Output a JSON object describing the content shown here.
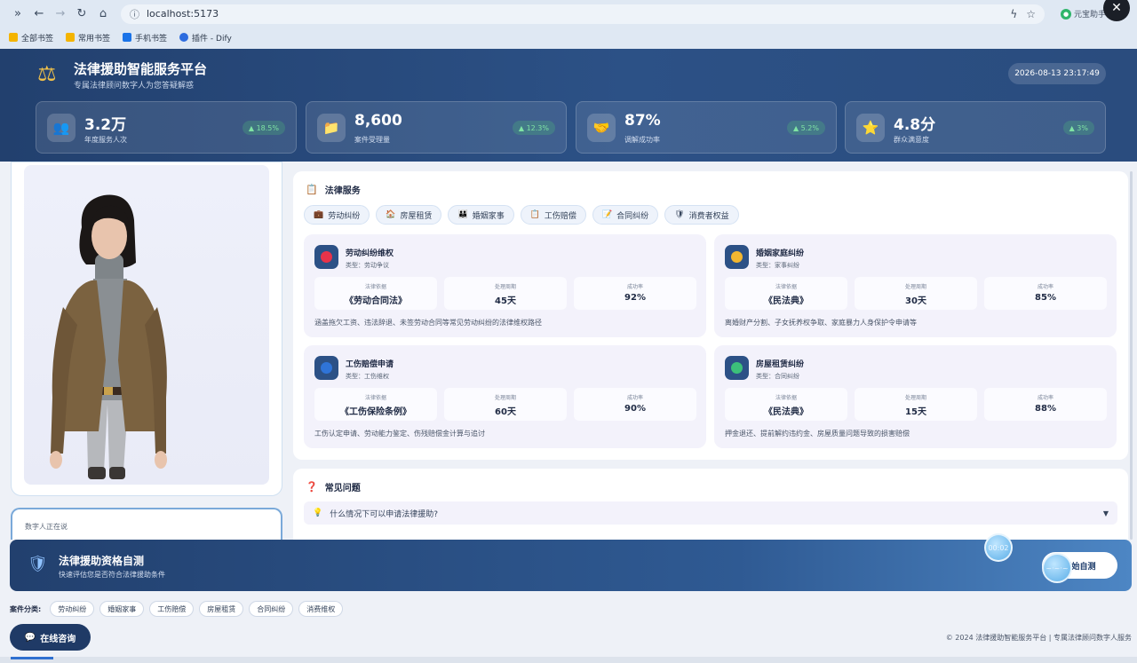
{
  "browser": {
    "url": "localhost:5173",
    "extension_label": "元宝助手",
    "bookmarks": [
      {
        "label": "全部书签",
        "color": "#f4b400"
      },
      {
        "label": "常用书签",
        "color": "#f4b400"
      },
      {
        "label": "手机书签",
        "color": "#1a73e8"
      },
      {
        "label": "插件 - Dify",
        "color": "#2d6cdf"
      }
    ]
  },
  "header": {
    "title": "法律援助智能服务平台",
    "subtitle": "专属法律顾问数字人为您答疑解惑",
    "datetime": "2026-08-13 23:17:49"
  },
  "stats": [
    {
      "value": "3.2万",
      "label": "年度服务人次",
      "trend": "▲ 18.5%",
      "icon": "users-icon",
      "glyph": "👥"
    },
    {
      "value": "8,600",
      "label": "案件受理量",
      "trend": "▲ 12.3%",
      "icon": "folder-icon",
      "glyph": "📁"
    },
    {
      "value": "87%",
      "label": "调解成功率",
      "trend": "▲ 5.2%",
      "icon": "handshake-icon",
      "glyph": "🤝"
    },
    {
      "value": "4.8分",
      "label": "群众满意度",
      "trend": "▲ 3%",
      "icon": "star-icon",
      "glyph": "⭐"
    }
  ],
  "avatar": {
    "speaking_text": "数字人正在说"
  },
  "services": {
    "title": "法律服务",
    "tags": [
      {
        "label": "劳动纠纷",
        "glyph": "💼"
      },
      {
        "label": "房屋租赁",
        "glyph": "🏠"
      },
      {
        "label": "婚姻家事",
        "glyph": "👪"
      },
      {
        "label": "工伤赔偿",
        "glyph": "📋"
      },
      {
        "label": "合同纠纷",
        "glyph": "📝"
      },
      {
        "label": "消费者权益",
        "glyph": "🛡"
      }
    ],
    "cards": [
      {
        "title": "劳动纠纷维权",
        "type": "类型：劳动争议",
        "basis_label": "法律依据",
        "basis": "《劳动合同法》",
        "period_label": "处理周期",
        "period": "45天",
        "rate_label": "成功率",
        "rate": "92%",
        "desc": "涵盖拖欠工资、违法辞退、未签劳动合同等常见劳动纠纷的法律维权路径",
        "dot": "#e8334a"
      },
      {
        "title": "婚姻家庭纠纷",
        "type": "类型：家事纠纷",
        "basis_label": "法律依据",
        "basis": "《民法典》",
        "period_label": "处理周期",
        "period": "30天",
        "rate_label": "成功率",
        "rate": "85%",
        "desc": "离婚财产分割、子女抚养权争取、家庭暴力人身保护令申请等",
        "dot": "#f2b630"
      },
      {
        "title": "工伤赔偿申请",
        "type": "类型：工伤维权",
        "basis_label": "法律依据",
        "basis": "《工伤保险条例》",
        "period_label": "处理周期",
        "period": "60天",
        "rate_label": "成功率",
        "rate": "90%",
        "desc": "工伤认定申请、劳动能力鉴定、伤残赔偿金计算与追讨",
        "dot": "#2f74d8"
      },
      {
        "title": "房屋租赁纠纷",
        "type": "类型：合同纠纷",
        "basis_label": "法律依据",
        "basis": "《民法典》",
        "period_label": "处理周期",
        "period": "15天",
        "rate_label": "成功率",
        "rate": "88%",
        "desc": "押金退还、提前解约违约金、房屋质量问题导致的损害赔偿",
        "dot": "#3cc07a"
      }
    ]
  },
  "faq": {
    "title": "常见问题",
    "items": [
      {
        "question": "什么情况下可以申请法律援助?"
      }
    ]
  },
  "banner": {
    "title": "法律援助资格自测",
    "subtitle": "快速评估您是否符合法律援助条件",
    "button": "开始自测",
    "bubble_time": "00:02",
    "bubble_text": "~·~·~"
  },
  "categories": {
    "label": "案件分类:",
    "items": [
      "劳动纠纷",
      "婚姻家事",
      "工伤赔偿",
      "房屋租赁",
      "合同纠纷",
      "消费维权"
    ]
  },
  "consult_button": "在线咨询",
  "footer": "© 2024 法律援助智能服务平台 | 专属法律顾问数字人服务"
}
